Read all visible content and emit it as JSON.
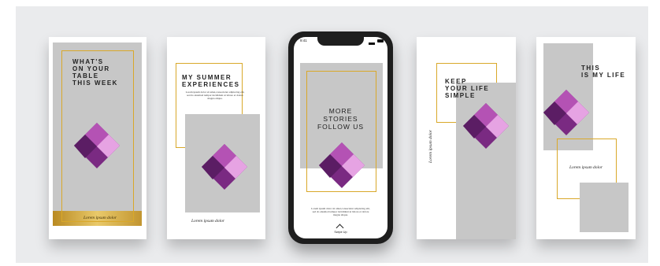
{
  "cards": [
    {
      "title": "WHAT'S\nON YOUR\nTABLE\nTHIS WEEK",
      "caption": "Lorem ipsum dolor"
    },
    {
      "title": "MY SUMMER\nEXPERIENCES",
      "body": "Lorem ipsum dolor sit amet,consectetur adipiscing elit, sed do eiusmod tempor incididunt ut labore et dolore magna aliqua.",
      "caption": "Lorem ipsum dolor"
    },
    {
      "title": "MORE\nSTORIES\nFOLLOW US",
      "body": "Lorem ipsum dolor sit amet,consectetur adipiscing elit, sed do eiusmod tempor incididunt ut labore et dolore magna aliqua.",
      "swipe": "Swipe Up",
      "time": "9:41"
    },
    {
      "title": "KEEP\nYOUR LIFE\nSIMPLE",
      "caption": "Lorem ipsum dolor"
    },
    {
      "title": "THIS\nIS MY LIFE",
      "caption": "Lorem ipsum dolor"
    }
  ],
  "colors": {
    "gold": "#d9a82a",
    "gray": "#c7c7c7",
    "logo_dark": "#7a2a82",
    "logo_mid": "#b452b4",
    "logo_light": "#e6a3e3"
  },
  "icons": [
    "power-apps-logo-icon",
    "chevron-up-icon",
    "signal-icon",
    "battery-icon"
  ]
}
